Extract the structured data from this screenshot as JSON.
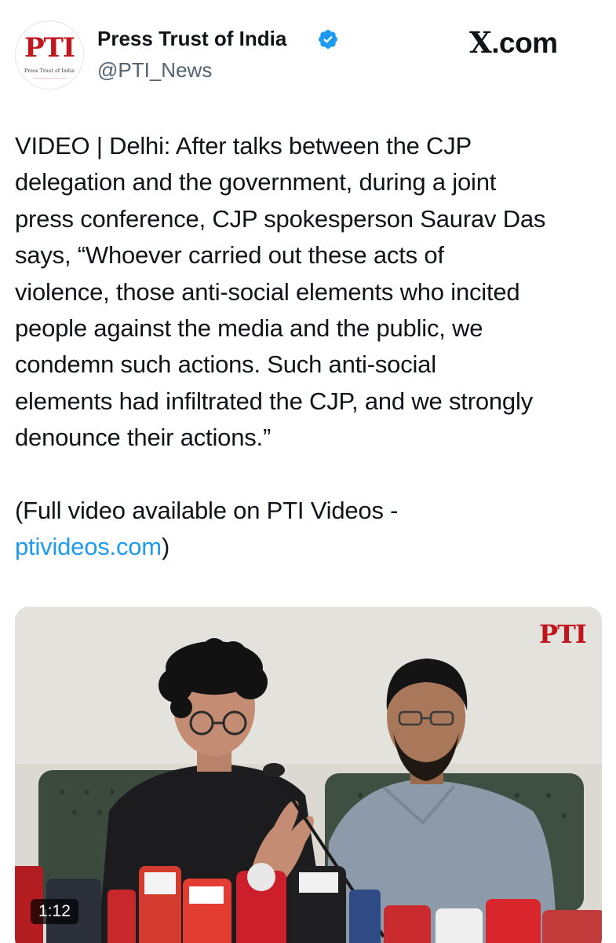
{
  "author": {
    "name": "Press Trust of India",
    "handle": "@PTI_News",
    "avatar_logo": "PTI",
    "avatar_subtitle": "Press Trust of India",
    "verified": true,
    "verified_color": "#1d9bf0"
  },
  "site": {
    "label": ".com",
    "logo": "X"
  },
  "tweet": {
    "lines": [
      "VIDEO | Delhi: After talks between the CJP",
      "delegation and the government, during a joint",
      "press conference, CJP spokesperson Saurav Das",
      "says, “Whoever carried out these acts of",
      "violence, those anti-social elements who incited",
      "people against the media and the public, we",
      "condemn such actions. Such anti-social",
      "elements had infiltrated the CJP, and we strongly",
      "denounce their actions.”"
    ],
    "note_line1": "(Full video available on PTI Videos -",
    "link_text": "ptivideos.com",
    "note_close": ")",
    "link_color": "#1d9bf0"
  },
  "video": {
    "watermark": "PTI",
    "duration": "1:12"
  }
}
